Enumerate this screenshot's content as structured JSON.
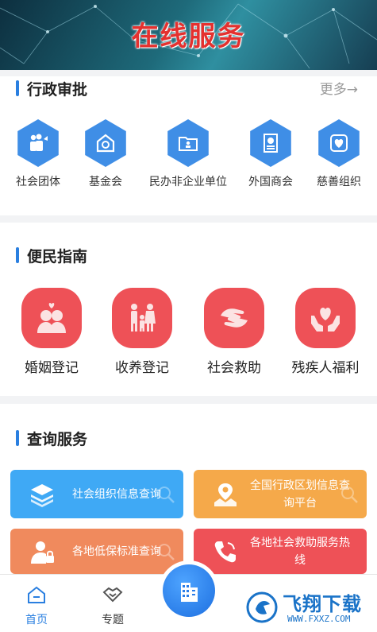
{
  "banner": {
    "title": "在线服务"
  },
  "admin": {
    "title": "行政审批",
    "more": "更多→",
    "items": [
      {
        "label": "社会团体",
        "icon": "people-group-icon"
      },
      {
        "label": "基金会",
        "icon": "money-box-icon"
      },
      {
        "label": "民办非企业单位",
        "icon": "folder-person-icon"
      },
      {
        "label": "外国商会",
        "icon": "document-globe-icon"
      },
      {
        "label": "慈善组织",
        "icon": "heart-icon"
      }
    ]
  },
  "guide": {
    "title": "便民指南",
    "items": [
      {
        "label": "婚姻登记",
        "icon": "couple-heart-icon"
      },
      {
        "label": "收养登记",
        "icon": "family-icon"
      },
      {
        "label": "社会救助",
        "icon": "helping-hands-icon"
      },
      {
        "label": "残疾人福利",
        "icon": "hands-heart-icon"
      }
    ]
  },
  "query": {
    "title": "查询服务",
    "tiles": [
      {
        "label": "社会组织信息查询",
        "icon": "layers-icon",
        "color": "#3fa9f5"
      },
      {
        "label": "全国行政区划信息查询平台",
        "line1": "全国行政区划信息查",
        "line2": "询平台",
        "icon": "map-pin-icon",
        "color": "#f5a94a"
      },
      {
        "label": "各地低保标准查询",
        "icon": "person-lock-icon",
        "color": "#f08a5d"
      },
      {
        "label": "各地社会救助服务热线",
        "line1": "各地社会救助服务热",
        "line2": "线",
        "icon": "phone-icon",
        "color": "#ee5157"
      }
    ]
  },
  "tabbar": {
    "tabs": [
      {
        "label": "首页",
        "icon": "home-icon",
        "active": true
      },
      {
        "label": "专题",
        "icon": "handshake-icon",
        "active": false
      }
    ],
    "center_icon": "buildings-icon"
  },
  "watermark": {
    "text": "飞翔下载",
    "url": "WWW.FXXZ.COM"
  },
  "colors": {
    "accent": "#2a7fe0",
    "hex": "#3f8ee6",
    "guide": "#ee5157",
    "banner_title": "#e4312f"
  }
}
